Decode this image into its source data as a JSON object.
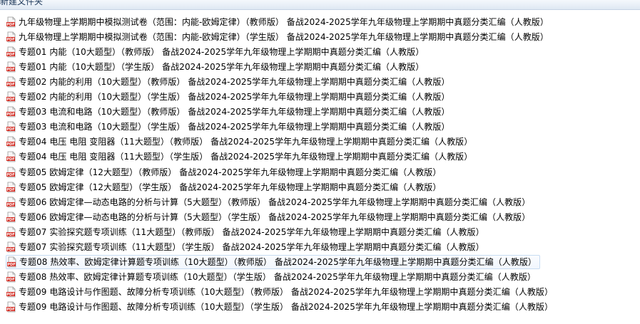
{
  "toolbar": {
    "new_folder_label": "新建文件夹"
  },
  "icon": {
    "name": "pdf-file-icon",
    "badge_text": "PDF",
    "color": "#d42a21"
  },
  "selected_index": 16,
  "files": [
    {
      "name": "九年级物理上学期期中模拟测试卷（范围：内能-欧姆定律）（教师版） 备战2024-2025学年九年级物理上学期期中真题分类汇编（人教版）"
    },
    {
      "name": "九年级物理上学期期中模拟测试卷（范围：内能-欧姆定律）（学生版） 备战2024-2025学年九年级物理上学期期中真题分类汇编（人教版）"
    },
    {
      "name": "专题01 内能（10大题型）（教师版） 备战2024-2025学年九年级物理上学期期中真题分类汇编（人教版）"
    },
    {
      "name": "专题01 内能（10大题型）（学生版） 备战2024-2025学年九年级物理上学期期中真题分类汇编（人教版）"
    },
    {
      "name": "专题02 内能的利用（10大题型）（教师版） 备战2024-2025学年九年级物理上学期期中真题分类汇编（人教版）"
    },
    {
      "name": "专题02 内能的利用（10大题型）（学生版） 备战2024-2025学年九年级物理上学期期中真题分类汇编（人教版）"
    },
    {
      "name": "专题03 电流和电路（10大题型）（教师版） 备战2024-2025学年九年级物理上学期期中真题分类汇编（人教版）"
    },
    {
      "name": "专题03 电流和电路（10大题型）（学生版） 备战2024-2025学年九年级物理上学期期中真题分类汇编（人教版）"
    },
    {
      "name": "专题04 电压 电阻 变阻器（11大题型）（教师版） 备战2024-2025学年九年级物理上学期期中真题分类汇编（人教版）"
    },
    {
      "name": "专题04 电压 电阻 变阻器（11大题型）（学生版） 备战2024-2025学年九年级物理上学期期中真题分类汇编（人教版）"
    },
    {
      "name": "专题05 欧姆定律（12大题型）（教师版） 备战2024-2025学年九年级物理上学期期中真题分类汇编（人教版）"
    },
    {
      "name": "专题05 欧姆定律（12大题型）（学生版） 备战2024-2025学年九年级物理上学期期中真题分类汇编（人教版）"
    },
    {
      "name": "专题06 欧姆定律—动态电路的分析与计算（5大题型）（教师版） 备战2024-2025学年九年级物理上学期期中真题分类汇编（人教版）"
    },
    {
      "name": "专题06 欧姆定律—动态电路的分析与计算（5大题型）（学生版） 备战2024-2025学年九年级物理上学期期中真题分类汇编（人教版）"
    },
    {
      "name": "专题07 实验探究题专项训练（11大题型）（教师版） 备战2024-2025学年九年级物理上学期期中真题分类汇编（人教版）"
    },
    {
      "name": "专题07 实验探究题专项训练（11大题型）（学生版） 备战2024-2025学年九年级物理上学期期中真题分类汇编（人教版）"
    },
    {
      "name": "专题08 热效率、欧姆定律计算题专项训练（10大题型）（教师版） 备战2024-2025学年九年级物理上学期期中真题分类汇编（人教版）"
    },
    {
      "name": "专题08 热效率、欧姆定律计算题专项训练（10大题型）（学生版） 备战2024-2025学年九年级物理上学期期中真题分类汇编（人教版）"
    },
    {
      "name": "专题09 电路设计与作图题、故障分析专项训练（10大题型）（教师版） 备战2024-2025学年九年级物理上学期期中真题分类汇编（人教版）"
    },
    {
      "name": "专题09 电路设计与作图题、故障分析专项训练（10大题型）（学生版） 备战2024-2025学年九年级物理上学期期中真题分类汇编（人教版）"
    }
  ]
}
